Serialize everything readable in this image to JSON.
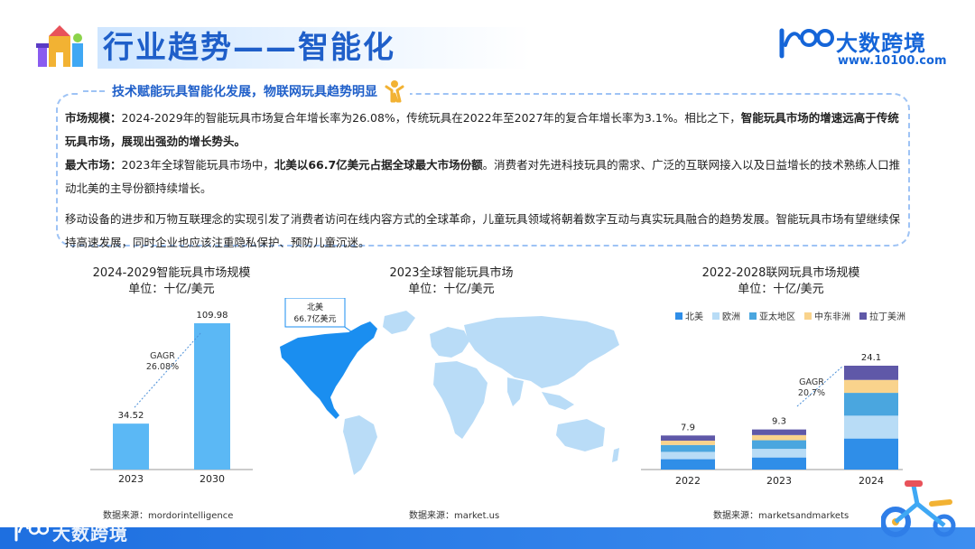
{
  "header": {
    "title": "行业趋势——智能化",
    "logo_name": "大数跨境",
    "logo_url": "www.10100.com"
  },
  "summary": {
    "subtitle": "技术赋能玩具智能化发展，物联网玩具趋势明显",
    "p1_label": "市场规模：",
    "p1_text": "2024-2029年的智能玩具市场复合年增长率为26.08%，传统玩具在2022年至2027年的复合年增长率为3.1%。相比之下，",
    "p1_bold": "智能玩具市场的增速远高于传统玩具市场，展现出强劲的增长势头。",
    "p2_label": "最大市场：",
    "p2_text": "2023年全球智能玩具市场中，",
    "p2_bold": "北美以66.7亿美元占据全球最大市场份额",
    "p2_rest": "。消费者对先进科技玩具的需求、广泛的互联网接入以及日益增长的技术熟练人口推动北美的主导份额持续增长。",
    "p3_text": "移动设备的进步和万物互联理念的实现引发了消费者访问在线内容方式的全球革命，儿童玩具领域将朝着数字互动与真实玩具融合的趋势发展。智能玩具市场有望继续保持高速发展，同时企业也应该注重隐私保护、预防儿童沉迷。"
  },
  "chart_data": [
    {
      "type": "bar",
      "title": "2024-2029智能玩具市场规模",
      "unit": "单位：十亿/美元",
      "categories": [
        "2023",
        "2030"
      ],
      "values": [
        34.52,
        109.98
      ],
      "value_labels": [
        "34.52",
        "109.98"
      ],
      "annotation": "GAGR\n26.08%",
      "color": "#5bb8f5",
      "source": "数据来源：mordorintelligence"
    },
    {
      "type": "map",
      "title": "2023全球智能玩具市场",
      "unit": "单位：十亿/美元",
      "callout": "北美\n66.7亿美元",
      "highlight_color": "#1a8ef0",
      "base_color": "#b9dcf7",
      "source": "数据来源：market.us"
    },
    {
      "type": "bar",
      "stacked": true,
      "title": "2022-2028联网玩具市场规模",
      "unit": "单位：十亿/美元",
      "categories": [
        "2022",
        "2023",
        "2024"
      ],
      "totals": [
        7.9,
        9.3,
        24.1
      ],
      "total_labels": [
        "7.9",
        "9.3",
        "24.1"
      ],
      "series": [
        {
          "name": "北美",
          "color": "#2f8ee8",
          "values": [
            2.4,
            2.8,
            7.2
          ]
        },
        {
          "name": "欧洲",
          "color": "#b8dcf6",
          "values": [
            1.7,
            2.0,
            5.3
          ]
        },
        {
          "name": "亚太地区",
          "color": "#4aa6df",
          "values": [
            1.6,
            2.0,
            5.3
          ]
        },
        {
          "name": "中东非洲",
          "color": "#f9d38c",
          "values": [
            1.0,
            1.2,
            3.0
          ]
        },
        {
          "name": "拉丁美洲",
          "color": "#5f58a8",
          "values": [
            1.2,
            1.3,
            3.3
          ]
        }
      ],
      "annotation": "GAGR\n20.7%",
      "source": "数据来源：marketsandmarkets"
    }
  ],
  "footer": {
    "logo_text": "大数跨境"
  }
}
